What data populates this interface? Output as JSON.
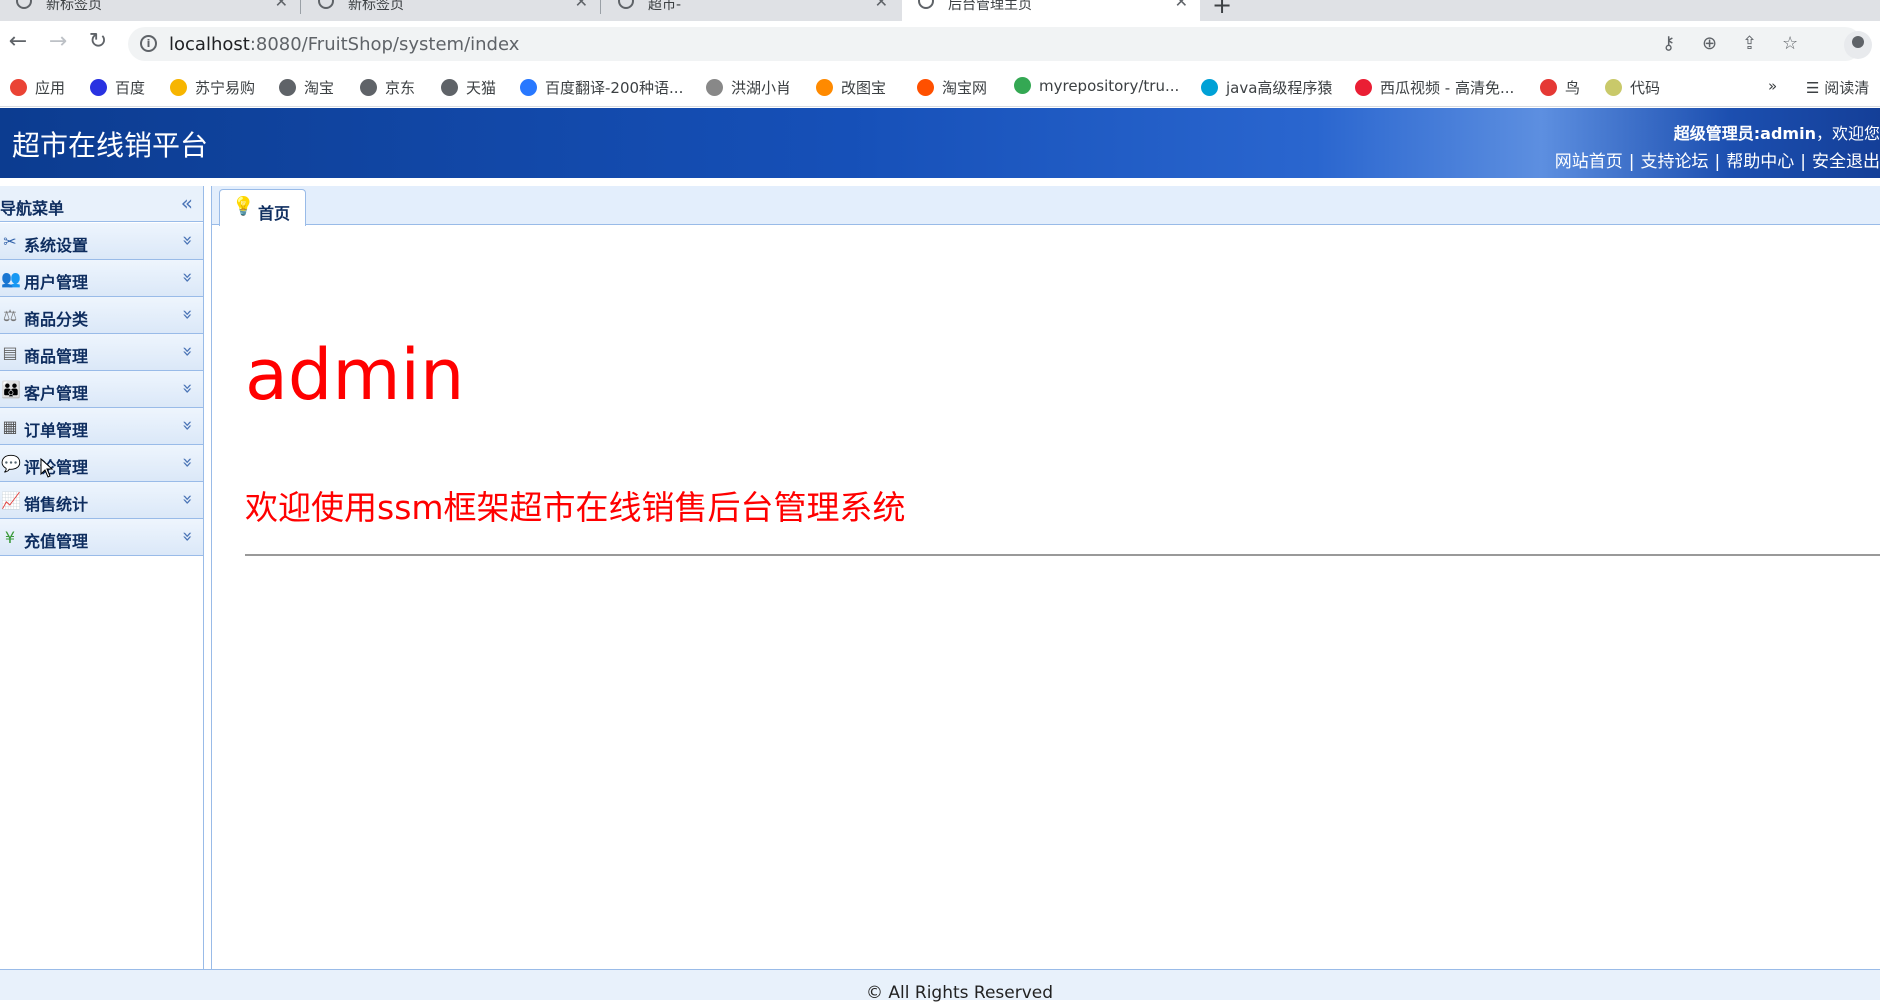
{
  "browser": {
    "tabs": [
      {
        "title": "新标签页"
      },
      {
        "title": "新标签页"
      },
      {
        "title": "超市-"
      },
      {
        "title": "后台管理主页"
      }
    ],
    "url_host": "localhost",
    "url_path": ":8080/FruitShop/system/index",
    "bookmarks": [
      {
        "label": "应用",
        "icon": "apps-grid-icon",
        "color": "#ea4335"
      },
      {
        "label": "百度",
        "icon": "baidu-paw-icon",
        "color": "#2932e1"
      },
      {
        "label": "苏宁易购",
        "icon": "suning-icon",
        "color": "#f7b500"
      },
      {
        "label": "淘宝",
        "icon": "globe-icon",
        "color": "#5f6368"
      },
      {
        "label": "京东",
        "icon": "globe-icon",
        "color": "#5f6368"
      },
      {
        "label": "天猫",
        "icon": "globe-icon",
        "color": "#5f6368"
      },
      {
        "label": "百度翻译-200种语...",
        "icon": "translate-icon",
        "color": "#2878ff"
      },
      {
        "label": "洪湖小肖",
        "icon": "bird-icon",
        "color": "#888888"
      },
      {
        "label": "改图宝",
        "icon": "gaitubao-icon",
        "color": "#ff8a00"
      },
      {
        "label": "淘宝网",
        "icon": "taobao-icon",
        "color": "#ff5000"
      },
      {
        "label": "myrepository/tru...",
        "icon": "chrome-icon",
        "color": "#34a853"
      },
      {
        "label": "java高级程序猿",
        "icon": "bilibili-icon",
        "color": "#00a1d6"
      },
      {
        "label": "西瓜视频 - 高清免...",
        "icon": "xigua-icon",
        "color": "#ea1e34"
      },
      {
        "label": "鸟",
        "icon": "bird-red-icon",
        "color": "#e53935"
      },
      {
        "label": "代码",
        "icon": "code-icon",
        "color": "#c9c96a"
      }
    ],
    "overflow_label": "»",
    "reading_list_label": "阅读清"
  },
  "header": {
    "title": "超市在线销平台",
    "user_bold": "超级管理员:admin",
    "user_tail": "，欢迎您",
    "links": [
      "网站首页",
      "支持论坛",
      "帮助中心",
      "安全退出"
    ]
  },
  "sidebar": {
    "title": "导航菜单",
    "items": [
      {
        "label": "系统设置",
        "icon": "tools-icon"
      },
      {
        "label": "用户管理",
        "icon": "users-icon"
      },
      {
        "label": "商品分类",
        "icon": "category-icon"
      },
      {
        "label": "商品管理",
        "icon": "goods-icon"
      },
      {
        "label": "客户管理",
        "icon": "customers-icon"
      },
      {
        "label": "订单管理",
        "icon": "orders-icon"
      },
      {
        "label": "评论管理",
        "icon": "comment-icon"
      },
      {
        "label": "销售统计",
        "icon": "chart-icon"
      },
      {
        "label": "充值管理",
        "icon": "yen-icon"
      }
    ]
  },
  "main": {
    "tab_label": "首页",
    "welcome_name": "admin",
    "welcome_message": "欢迎使用ssm框架超市在线销售后台管理系统"
  },
  "footer": {
    "text": "© All Rights Reserved"
  },
  "colors": {
    "accent": "#1650b8",
    "welcome_text": "#ff0000",
    "panel_border": "#99bbe8"
  }
}
